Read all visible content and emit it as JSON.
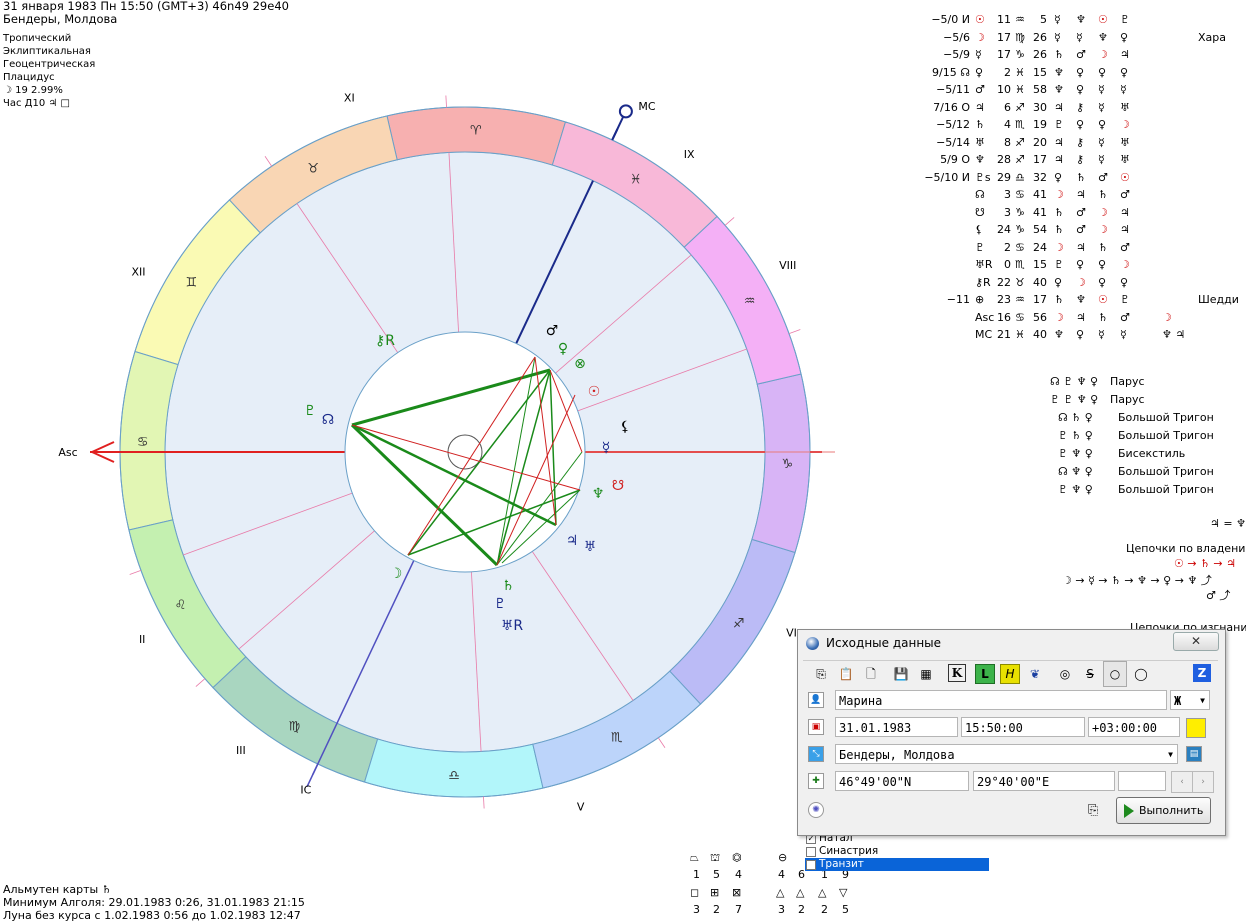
{
  "header": {
    "line1": "31 января 1983  Пн  15:50 (GMT+3) 46n49  29e40",
    "line2": "Бендеры, Молдова"
  },
  "chart_info": [
    "Тропический",
    "Эклиптикальная",
    "Геоцентрическая",
    "Плацидус",
    "☽  19 2.99%",
    "Час Д10  ♃  □"
  ],
  "houses": {
    "I": "Asc",
    "II": "II",
    "III": "III",
    "IC": "IC",
    "V": "V",
    "VI": "VI",
    "VII": "Dsc",
    "VIII": "VIII",
    "IX": "IX",
    "MC": "MC",
    "XI": "XI",
    "XII": "XII"
  },
  "planet_table": [
    [
      "−5/0 И",
      "☉",
      "11",
      "♒",
      "5",
      "☿",
      "♆",
      "☉",
      "♇",
      ""
    ],
    [
      "−5/6",
      "☽",
      "17",
      "♍",
      "26",
      "☿",
      "☿",
      "♆",
      "♀",
      "Хара"
    ],
    [
      "−5/9",
      "☿",
      "17",
      "♑",
      "26",
      "♄",
      "♂",
      "☽",
      "♃",
      ""
    ],
    [
      "9/15 ☊",
      "♀",
      "2",
      "♓",
      "15",
      "♆",
      "♀",
      "♀",
      "♀",
      ""
    ],
    [
      "−5/11",
      "♂",
      "10",
      "♓",
      "58",
      "♆",
      "♀",
      "☿",
      "☿",
      ""
    ],
    [
      "7/16 О",
      "♃",
      "6",
      "♐",
      "30",
      "♃",
      "⚷",
      "☿",
      "♅",
      ""
    ],
    [
      "−5/12",
      "♄",
      "4",
      "♏",
      "19",
      "♇",
      "♀",
      "♀",
      "☽",
      ""
    ],
    [
      "−5/14",
      "♅",
      "8",
      "♐",
      "20",
      "♃",
      "⚷",
      "☿",
      "♅",
      ""
    ],
    [
      "5/9 О",
      "♆",
      "28",
      "♐",
      "17",
      "♃",
      "⚷",
      "☿",
      "♅",
      ""
    ],
    [
      "−5/10 И",
      "♇s",
      "29",
      "♎",
      "32",
      "♀",
      "♄",
      "♂",
      "☉",
      ""
    ],
    [
      "",
      "☊",
      "3",
      "♋",
      "41",
      "☽",
      "♃",
      "♄",
      "♂",
      ""
    ],
    [
      "",
      "☋",
      "3",
      "♑",
      "41",
      "♄",
      "♂",
      "☽",
      "♃",
      ""
    ],
    [
      "",
      "⚸",
      "24",
      "♑",
      "54",
      "♄",
      "♂",
      "☽",
      "♃",
      ""
    ],
    [
      "",
      "♇",
      "2",
      "♋",
      "24",
      "☽",
      "♃",
      "♄",
      "♂",
      ""
    ],
    [
      "",
      "♅R",
      "0",
      "♏",
      "15",
      "♇",
      "♀",
      "♀",
      "☽",
      ""
    ],
    [
      "",
      "⚷R",
      "22",
      "♉",
      "40",
      "♀",
      "☽",
      "♀",
      "♀",
      ""
    ],
    [
      "−11",
      "⊕",
      "23",
      "♒",
      "17",
      "♄",
      "♆",
      "☉",
      "♇",
      "Шедди"
    ],
    [
      "",
      "Asc",
      "16",
      "♋",
      "56",
      "☽",
      "♃",
      "♄",
      "♂",
      "☽"
    ],
    [
      "",
      "MC",
      "21",
      "♓",
      "40",
      "♆",
      "♀",
      "☿",
      "☿",
      "♆ ♃"
    ]
  ],
  "aspect_figures": [
    {
      "glyphs": "☊ ♇ ♆ ♀",
      "name": "Парус"
    },
    {
      "glyphs": "♇ ♇ ♆ ♀",
      "name": "Парус"
    },
    {
      "glyphs": "☊ ♄ ♀",
      "name": "Большой Тригон"
    },
    {
      "glyphs": "♇ ♄ ♀",
      "name": "Большой Тригон"
    },
    {
      "glyphs": "♇ ♆ ♀",
      "name": "Бисекстиль"
    },
    {
      "glyphs": "☊ ♆ ♀",
      "name": "Большой Тригон"
    },
    {
      "glyphs": "♇ ♆ ♀",
      "name": "Большой Тригон"
    }
  ],
  "right_extra": {
    "eq": "♃ = ♆",
    "chains_title": "Цепочки по владени",
    "chain1": "☉ → ♄ → ♃",
    "chain2": "☽ → ☿ → ♄ → ♆ → ♀ → ♆ ⤴",
    "chain3": "♂ ⤴",
    "chains_title2": "Цепочки по изгнани"
  },
  "bottom": {
    "almuten": "Альмутен карты   ♄",
    "algol": "Минимум Алголя: 29.01.1983  0:26,  31.01.1983 21:15",
    "void": "Луна без курса с 1.02.1983  0:56 до 1.02.1983 12:47"
  },
  "dialog": {
    "title": "Исходные данные",
    "close": "✕",
    "name": "Марина",
    "gender": "Ж",
    "date": "31.01.1983",
    "time": "15:50:00",
    "tz": "+03:00:00",
    "place": "Бендеры, Молдова",
    "lat": "46°49'00\"N",
    "lon": "29°40'00\"E",
    "run": "Выполнить"
  },
  "modes": [
    "Натал",
    "Синастрия",
    "Транзит"
  ],
  "layout_icons": [
    {
      "num": "1"
    },
    {
      "num": "5"
    },
    {
      "num": "4"
    },
    {
      "num": "4"
    },
    {
      "num": "6"
    },
    {
      "num": "1"
    },
    {
      "num": "9"
    }
  ],
  "layout_icons2": [
    "3",
    "2",
    "7",
    "3",
    "2",
    "2",
    "5"
  ]
}
